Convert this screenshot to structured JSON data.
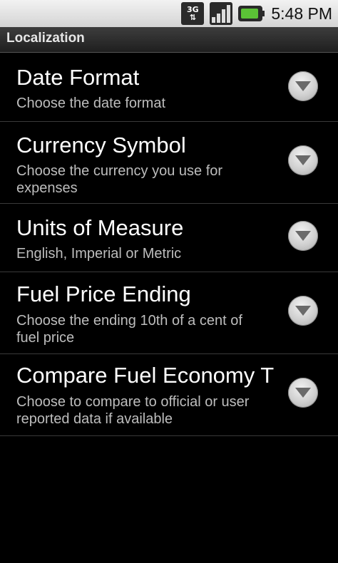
{
  "status_bar": {
    "network_label_top": "3G",
    "network_label_bottom": "⇅",
    "time": "5:48 PM",
    "icons": [
      "network-3g-icon",
      "signal-strength-icon",
      "battery-charging-icon"
    ]
  },
  "header": {
    "title": "Localization"
  },
  "preferences": [
    {
      "title": "Date Format",
      "summary": "Choose the date format",
      "icon": "dropdown-arrow-icon"
    },
    {
      "title": "Currency Symbol",
      "summary": "Choose the currency you use for expenses",
      "icon": "dropdown-arrow-icon"
    },
    {
      "title": "Units of Measure",
      "summary": "English, Imperial or Metric",
      "icon": "dropdown-arrow-icon"
    },
    {
      "title": "Fuel Price Ending",
      "summary": "Choose the ending 10th of a cent of fuel price",
      "icon": "dropdown-arrow-icon"
    },
    {
      "title": "Compare Fuel Economy T",
      "summary": "Choose to compare to official or user reported data if available",
      "icon": "dropdown-arrow-icon"
    }
  ],
  "colors": {
    "accent_battery": "#5bc236",
    "background": "#000000",
    "summary_text": "#bdbdbd"
  }
}
